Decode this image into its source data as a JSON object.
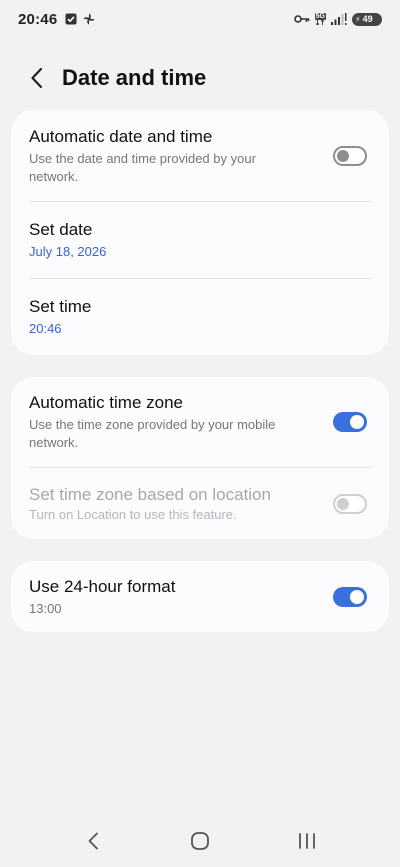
{
  "status_bar": {
    "time": "20:46",
    "network": "5G",
    "battery": "49"
  },
  "header": {
    "title": "Date and time"
  },
  "group1": {
    "auto_datetime": {
      "title": "Automatic date and time",
      "subtitle": "Use the date and time provided by your network.",
      "enabled": false
    },
    "set_date": {
      "title": "Set date",
      "value": "July 18, 2026"
    },
    "set_time": {
      "title": "Set time",
      "value": "20:46"
    }
  },
  "group2": {
    "auto_timezone": {
      "title": "Automatic time zone",
      "subtitle": "Use the time zone provided by your mobile network.",
      "enabled": true
    },
    "location_timezone": {
      "title": "Set time zone based on location",
      "subtitle": "Turn on Location to use this feature.",
      "enabled": false,
      "disabled": true
    }
  },
  "group3": {
    "format_24h": {
      "title": "Use 24-hour format",
      "subtitle": "13:00",
      "enabled": true
    }
  },
  "colors": {
    "accent": "#3a6fe0",
    "link_blue": "#3a64d8",
    "background": "#f2f2f5",
    "card": "#fcfcfe"
  },
  "icons": {
    "status_left": [
      "checkbox-notification-icon",
      "pinwheel-notification-icon"
    ],
    "status_right": [
      "key-icon",
      "5g-network-icon",
      "signal-icon",
      "battery-icon"
    ],
    "nav": [
      "back-nav-icon",
      "home-nav-icon",
      "recents-nav-icon"
    ]
  }
}
